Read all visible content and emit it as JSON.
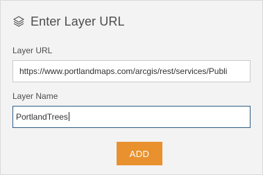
{
  "header": {
    "icon": "layers-icon",
    "title": "Enter Layer URL"
  },
  "form": {
    "layer_url_label": "Layer URL",
    "layer_url_value": "https://www.portlandmaps.com/arcgis/rest/services/Publi",
    "layer_name_label": "Layer Name",
    "layer_name_value": "PortlandTrees"
  },
  "actions": {
    "add_label": "ADD",
    "add_color": "#e8912e"
  }
}
